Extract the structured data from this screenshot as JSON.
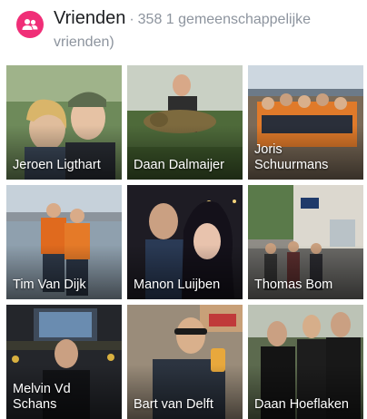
{
  "header": {
    "icon": "friends-icon",
    "accent_color": "#f02e77",
    "title": "Vrienden",
    "separator": "·",
    "subtitle": "358 1 gemeenschappelijke vrienden)"
  },
  "friends": [
    {
      "name": "Jeroen Ligthart"
    },
    {
      "name": "Daan Dalmaijer"
    },
    {
      "name": "Joris Schuurmans"
    },
    {
      "name": "Tim Van Dijk"
    },
    {
      "name": "Manon Luijben"
    },
    {
      "name": "Thomas Bom"
    },
    {
      "name": "Melvin Vd Schans"
    },
    {
      "name": "Bart van Delft"
    },
    {
      "name": "Daan Hoeflaken"
    }
  ]
}
